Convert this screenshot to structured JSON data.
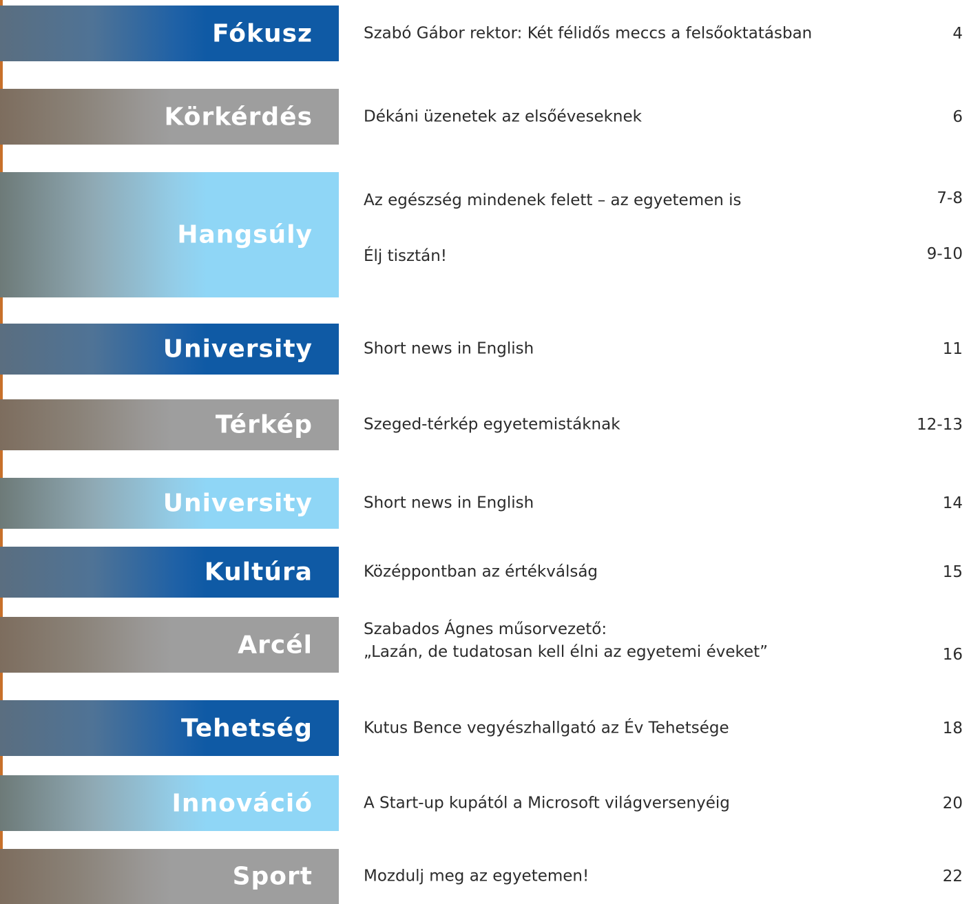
{
  "rows": [
    {
      "category": "Fókusz",
      "title": "Szabó Gábor rektor: Két félidős meccs a felsőoktatásban",
      "page": "4"
    },
    {
      "category": "Körkérdés",
      "title": "Dékáni üzenetek az elsőéveseknek",
      "page": "6"
    },
    {
      "category": "Hangsúly",
      "articles": [
        {
          "title": "Az egészség mindenek felett – az egyetemen is",
          "page": "7-8"
        },
        {
          "title": "Élj tisztán!",
          "page": "9-10"
        }
      ]
    },
    {
      "category": "University",
      "title": "Short news in English",
      "page": "11"
    },
    {
      "category": "Térkép",
      "title": "Szeged-térkép egyetemistáknak",
      "page": "12-13"
    },
    {
      "category": "University",
      "title": "Short news in English",
      "page": "14"
    },
    {
      "category": "Kultúra",
      "title": "Középpontban az értékválság",
      "page": "15"
    },
    {
      "category": "Arcél",
      "title_line1": "Szabados Ágnes műsorvezető:",
      "title_line2": "„Lazán, de tudatosan kell élni az egyetemi éveket”",
      "page": "16"
    },
    {
      "category": "Tehetség",
      "title": "Kutus Bence vegyészhallgató az Év Tehetsége",
      "page": "18"
    },
    {
      "category": "Innováció",
      "title": "A Start-up kupától a Microsoft világversenyéig",
      "page": "20"
    },
    {
      "category": "Sport",
      "title": "Mozdulj meg az egyetemen!",
      "page": "22"
    }
  ],
  "colors": {
    "dark": "#0f5aa5",
    "gray": "#9e9e9e",
    "light": "#8fd6f6",
    "accent_edge": "#c8702a"
  }
}
